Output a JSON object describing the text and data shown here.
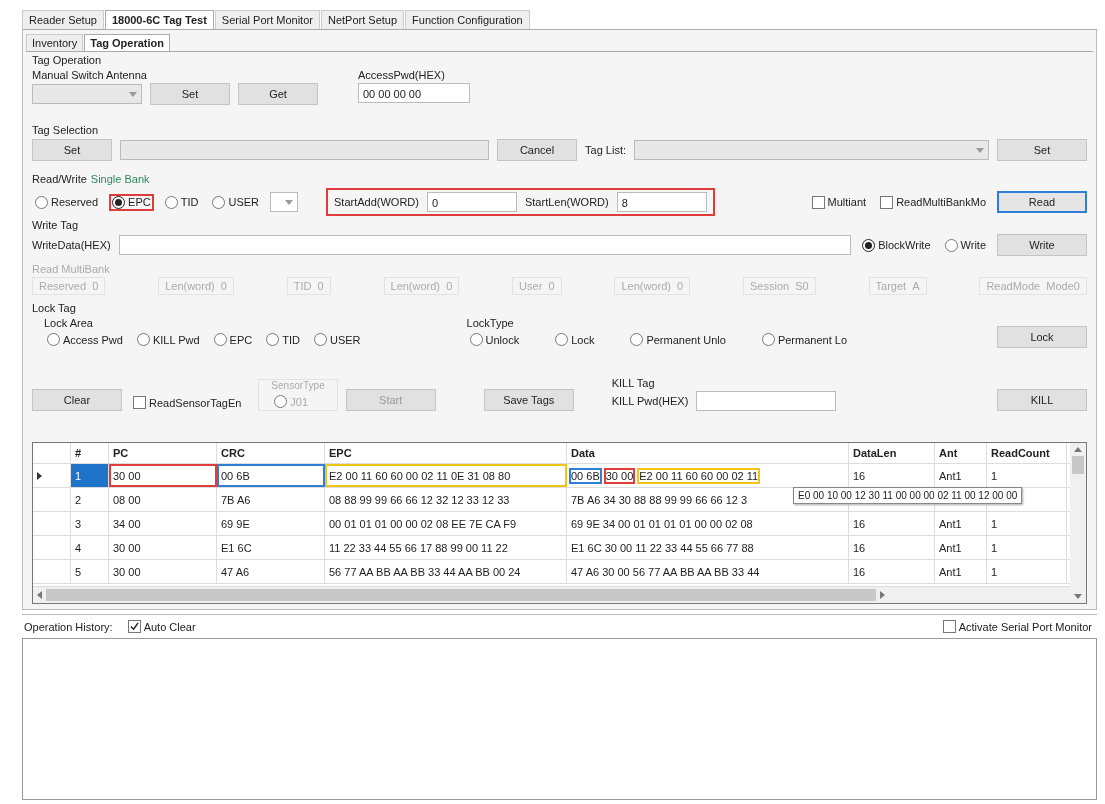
{
  "main_tabs": [
    {
      "label": "Reader Setup",
      "selected": false
    },
    {
      "label": "18000-6C Tag Test",
      "selected": true
    },
    {
      "label": "Serial Port Monitor",
      "selected": false
    },
    {
      "label": "NetPort Setup",
      "selected": false
    },
    {
      "label": "Function Configuration",
      "selected": false
    }
  ],
  "sub_tabs": [
    {
      "label": "Inventory",
      "selected": false
    },
    {
      "label": "Tag Operation",
      "selected": true
    }
  ],
  "tag_operation": {
    "title": "Tag Operation",
    "antenna": {
      "label": "Manual Switch Antenna",
      "set": "Set",
      "get": "Get"
    },
    "access_pwd": {
      "label": "AccessPwd(HEX)",
      "value": "00 00 00 00"
    },
    "tag_selection": {
      "label": "Tag Selection",
      "set": "Set",
      "cancel": "Cancel",
      "list_label": "Tag List:",
      "list_set": "Set"
    },
    "read_write": {
      "label": "Read/Write",
      "label_link": "Single Bank",
      "banks": [
        {
          "label": "Reserved",
          "selected": false
        },
        {
          "label": "EPC",
          "selected": true,
          "color": "#e03c3c"
        },
        {
          "label": "TID",
          "selected": false
        },
        {
          "label": "USER",
          "selected": false
        }
      ],
      "range": {
        "color": "#e03c3c"
      },
      "start_add": {
        "label": "StartAdd(WORD)",
        "value": "0"
      },
      "start_len": {
        "label": "StartLen(WORD)",
        "value": "8"
      },
      "options": [
        {
          "label": "Multiant",
          "checked": false
        },
        {
          "label": "ReadMultiBankMo",
          "checked": false
        }
      ],
      "read_button": {
        "label": "Read",
        "color": "#2f7fd6"
      }
    },
    "write_tag": {
      "label": "Write Tag",
      "data_label": "WriteData(HEX)",
      "modes": [
        {
          "label": "BlockWrite",
          "selected": true
        },
        {
          "label": "Write",
          "selected": false
        }
      ],
      "button": "Write"
    },
    "multibank": {
      "label": "Read MultiBank",
      "disabled": true,
      "fields": [
        {
          "label": "Reserved",
          "value": "0"
        },
        {
          "label": "Len(word)",
          "value": "0"
        },
        {
          "label": "TID",
          "value": "0"
        },
        {
          "label": "Len(word)",
          "value": "0"
        },
        {
          "label": "User",
          "value": "0"
        },
        {
          "label": "Len(word)",
          "value": "0"
        },
        {
          "label": "Session",
          "value": "S0"
        },
        {
          "label": "Target",
          "value": "A"
        },
        {
          "label": "ReadMode",
          "value": "Mode0"
        }
      ]
    },
    "lock_tag": {
      "label": "Lock Tag",
      "area_label": "Lock Area",
      "areas": [
        {
          "label": "Access Pwd",
          "selected": false
        },
        {
          "label": "KILL Pwd",
          "selected": false
        },
        {
          "label": "EPC",
          "selected": false
        },
        {
          "label": "TID",
          "selected": false
        },
        {
          "label": "USER",
          "selected": false
        }
      ],
      "type_label": "LockType",
      "types": [
        {
          "label": "Unlock",
          "selected": false
        },
        {
          "label": "Lock",
          "selected": false
        },
        {
          "label": "Permanent Unlo",
          "selected": false
        },
        {
          "label": "Permanent Lo",
          "selected": false
        }
      ],
      "button": "Lock"
    },
    "actions": {
      "clear": "Clear",
      "sensor_checkbox": {
        "label": "ReadSensorTagEn",
        "checked": false
      },
      "sensor_type": {
        "label": "SensorType",
        "option": "J01",
        "selected": false,
        "disabled": true
      },
      "start": "Start",
      "save": "Save Tags"
    },
    "kill_tag": {
      "label": "KILL Tag",
      "pwd_label": "KILL Pwd(HEX)",
      "button": "KILL"
    }
  },
  "table": {
    "columns": [
      "#",
      "PC",
      "CRC",
      "EPC",
      "Data",
      "DataLen",
      "Ant",
      "ReadCount"
    ],
    "rows": [
      {
        "selected": true,
        "num": "1",
        "pc": {
          "text": "30 00",
          "color": "#e03c3c"
        },
        "crc": {
          "text": "00 6B",
          "color": "#2f7fd6"
        },
        "epc": {
          "text": "E2 00 11 60 60 00 02 11 0E 31 08 80",
          "color": "#f0c419"
        },
        "data": [
          {
            "text": "00 6B",
            "color": "#2f7fd6"
          },
          {
            "text": "30 00",
            "color": "#e03c3c"
          },
          {
            "text": "E2 00 11 60 60 00 02 11",
            "color": "#f0c419"
          }
        ],
        "datalen": "16",
        "ant": "Ant1",
        "count": "1"
      },
      {
        "selected": false,
        "num": "2",
        "pc": {
          "text": "08 00"
        },
        "crc": {
          "text": "7B A6"
        },
        "epc": {
          "text": "08 88 99 99 66 66 12 32 12 33 12 33"
        },
        "data": [
          {
            "text": "7B A6 34 30 88 88 99 99 66 66 12 3"
          }
        ]
      },
      {
        "selected": false,
        "num": "3",
        "pc": {
          "text": "34 00"
        },
        "crc": {
          "text": "69 9E"
        },
        "epc": {
          "text": "00 01 01 01 00 00 02 08 EE 7E CA F9"
        },
        "data": [
          {
            "text": "69 9E 34 00 01 01 01 01 00 00 02 08"
          }
        ],
        "datalen": "16",
        "ant": "Ant1",
        "count": "1"
      },
      {
        "selected": false,
        "num": "4",
        "pc": {
          "text": "30 00"
        },
        "crc": {
          "text": "E1 6C"
        },
        "epc": {
          "text": "11 22 33 44 55 66 17 88 99 00 11 22"
        },
        "data": [
          {
            "text": "E1 6C 30 00 11 22 33 44 55 66 77 88"
          }
        ],
        "datalen": "16",
        "ant": "Ant1",
        "count": "1"
      },
      {
        "selected": false,
        "num": "5",
        "pc": {
          "text": "30 00"
        },
        "crc": {
          "text": "47 A6"
        },
        "epc": {
          "text": "56 77 AA BB AA BB 33 44 AA BB 00 24"
        },
        "data": [
          {
            "text": "47 A6 30 00 56 77 AA BB AA BB 33 44"
          }
        ],
        "datalen": "16",
        "ant": "Ant1",
        "count": "1"
      }
    ],
    "tooltip": "E0 00 10 00 12 30 11 00 00 00 02 11 00 12 00 00"
  },
  "history": {
    "label": "Operation History:",
    "auto_clear": {
      "label": "Auto Clear",
      "checked": true
    },
    "monitor": {
      "label": "Activate Serial Port Monitor",
      "checked": false
    }
  }
}
